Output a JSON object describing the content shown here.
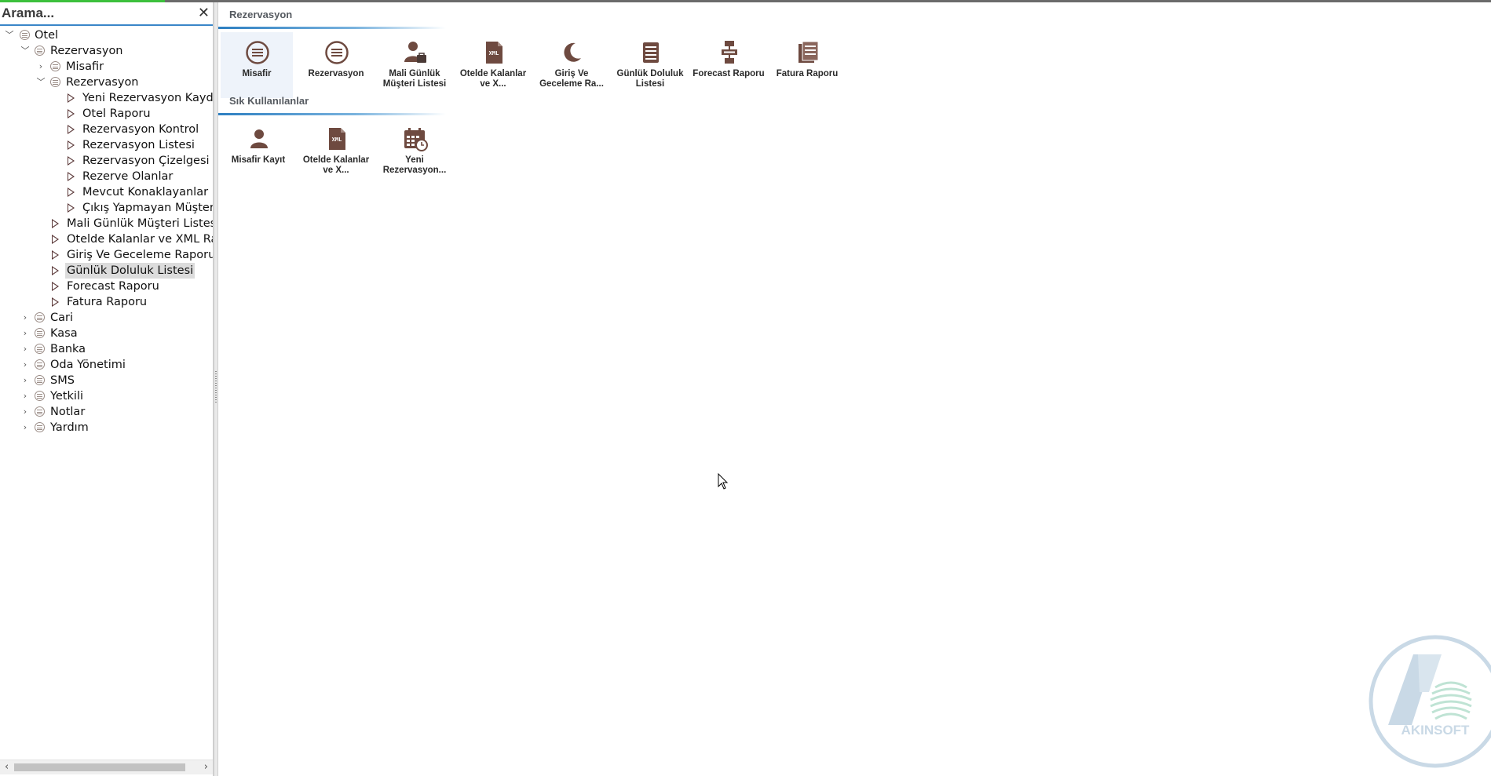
{
  "search": {
    "placeholder": "Arama...",
    "close_symbol": "✕"
  },
  "tree": {
    "root": "Otel",
    "rezervasyon_group": "Rezervasyon",
    "misafir": "Misafir",
    "rezervasyon_sub": "Rezervasyon",
    "rezervasyon_children": [
      "Yeni Rezervasyon Kaydı",
      "Otel Raporu",
      "Rezervasyon Kontrol",
      "Rezervasyon Listesi",
      "Rezervasyon Çizelgesi",
      "Rezerve Olanlar",
      "Mevcut Konaklayanlar",
      "Çıkış Yapmayan Müşterile"
    ],
    "reports": [
      "Mali Günlük Müşteri Listesi",
      "Otelde Kalanlar ve XML Rapo",
      "Giriş Ve Geceleme Raporu",
      "Günlük Doluluk Listesi",
      "Forecast Raporu",
      "Fatura Raporu"
    ],
    "modules": [
      "Cari",
      "Kasa",
      "Banka",
      "Oda Yönetimi",
      "SMS",
      "Yetkili",
      "Notlar",
      "Yardım"
    ],
    "selected": "Günlük Doluluk Listesi"
  },
  "main": {
    "section1_title": "Rezervasyon",
    "section1_tiles": [
      {
        "label": "Misafir",
        "icon": "list-circle-icon"
      },
      {
        "label": "Rezervasyon",
        "icon": "list-circle-icon"
      },
      {
        "label": "Mali Günlük Müşteri Listesi",
        "icon": "person-briefcase-icon"
      },
      {
        "label": "Otelde Kalanlar ve X...",
        "icon": "xml-file-icon"
      },
      {
        "label": "Giriş Ve Geceleme Ra...",
        "icon": "moon-icon"
      },
      {
        "label": "Günlük Doluluk Listesi",
        "icon": "document-lines-icon"
      },
      {
        "label": "Forecast Raporu",
        "icon": "flowchart-icon"
      },
      {
        "label": "Fatura Raporu",
        "icon": "invoice-icon"
      }
    ],
    "section2_title": "Sık Kullanılanlar",
    "section2_tiles": [
      {
        "label": "Misafir Kayıt",
        "icon": "person-icon"
      },
      {
        "label": "Otelde Kalanlar ve X...",
        "icon": "xml-file-icon"
      },
      {
        "label": "Yeni Rezervasyon...",
        "icon": "calendar-clock-icon"
      }
    ]
  },
  "logo": {
    "text": "AKINSOFT"
  },
  "colors": {
    "icon": "#6e4a40",
    "accent": "#2d7fc1",
    "logo": "#c9d9e6"
  }
}
